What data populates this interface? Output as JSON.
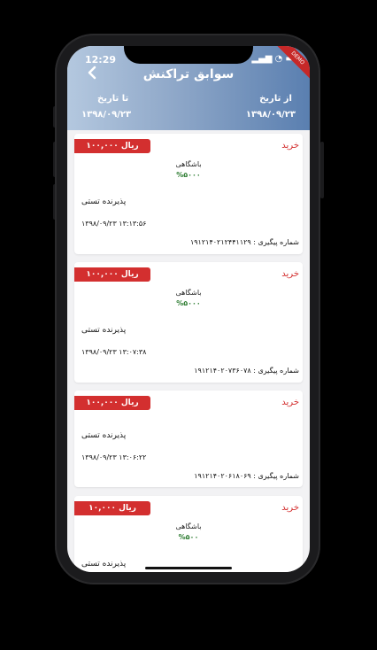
{
  "status_bar": {
    "time": "12:29",
    "icons": "▂▄▆ ◔ ▬",
    "ribbon": "DEMO"
  },
  "header": {
    "title": "سوابق تراکنش",
    "back_icon": "chevron-left-icon"
  },
  "filters": {
    "from_label": "از تاریخ",
    "from_value": "۱۳۹۸/۰۹/۲۳",
    "to_label": "تا تاریخ",
    "to_value": "۱۳۹۸/۰۹/۲۳"
  },
  "transactions": [
    {
      "amount": "۱۰۰,۰۰۰ ریال",
      "type": "خرید",
      "club": "باشگاهی",
      "percent": "%۵۰۰۰",
      "merchant": "پذیرنده تستی",
      "datetime": "۱۳۹۸/۰۹/۲۳ ۱۳:۱۳:۵۶",
      "tracking": "شماره پیگیری : ۱۹۱۲۱۴۰۲۱۲۴۴۱۱۲۹"
    },
    {
      "amount": "۱۰۰,۰۰۰ ریال",
      "type": "خرید",
      "club": "باشگاهی",
      "percent": "%۵۰۰۰",
      "merchant": "پذیرنده تستی",
      "datetime": "۱۳۹۸/۰۹/۲۳ ۱۳:۰۷:۳۸",
      "tracking": "شماره پیگیری : ۱۹۱۲۱۴۰۲۰۷۳۶۰۷۸"
    },
    {
      "amount": "۱۰۰,۰۰۰ ریال",
      "type": "خرید",
      "merchant": "پذیرنده تستی",
      "datetime": "۱۳۹۸/۰۹/۲۳ ۱۳:۰۶:۲۲",
      "tracking": "شماره پیگیری : ۱۹۱۲۱۴۰۲۰۶۱۸۰۶۹"
    },
    {
      "amount": "۱۰,۰۰۰ ریال",
      "type": "خرید",
      "club": "باشگاهی",
      "percent": "%۵۰۰",
      "merchant": "پذیرنده تستی"
    }
  ]
}
